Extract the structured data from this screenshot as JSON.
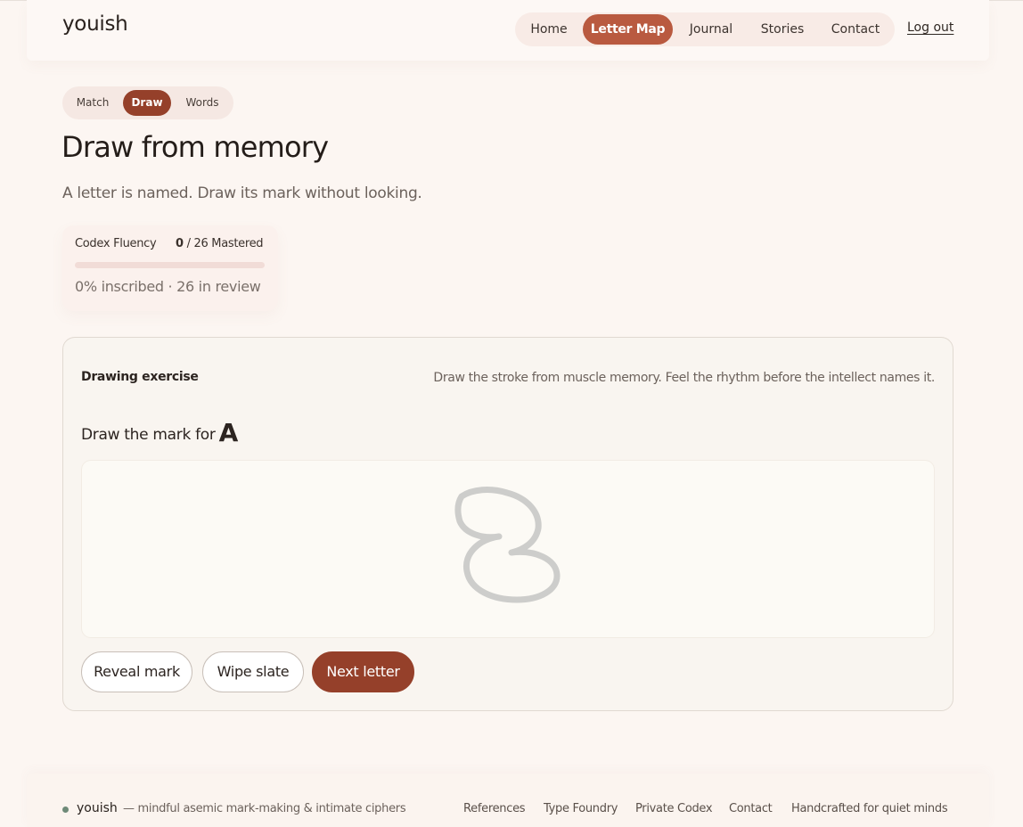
{
  "brand": "youish",
  "nav": {
    "items": [
      {
        "label": "Home",
        "active": false
      },
      {
        "label": "Letter Map",
        "active": true
      },
      {
        "label": "Journal",
        "active": false
      },
      {
        "label": "Stories",
        "active": false
      },
      {
        "label": "Contact",
        "active": false
      }
    ],
    "logout": "Log out"
  },
  "modes": [
    {
      "label": "Match",
      "active": false
    },
    {
      "label": "Draw",
      "active": true
    },
    {
      "label": "Words",
      "active": false
    }
  ],
  "page": {
    "title": "Draw from memory",
    "subtitle": "A letter is named. Draw its mark without looking."
  },
  "fluency": {
    "label": "Codex Fluency",
    "mastered_count": "0",
    "mastered_suffix": "/ 26 Mastered",
    "progress_fraction": 0,
    "stat": "0% inscribed · 26 in review"
  },
  "exercise": {
    "title": "Drawing exercise",
    "hint": "Draw the stroke from muscle memory. Feel the rhythm before the intellect names it.",
    "prompt": "Draw the mark for",
    "letter": "A",
    "buttons": {
      "reveal": "Reveal mark",
      "wipe": "Wipe slate",
      "next": "Next letter"
    }
  },
  "footer": {
    "brand": "youish",
    "tagline": "— mindful asemic mark-making & intimate ciphers",
    "links": [
      "References",
      "Type Foundry",
      "Private Codex",
      "Contact",
      "Handcrafted for quiet minds"
    ]
  },
  "colors": {
    "accent": "#b95a40",
    "accent_dark": "#95402a",
    "background": "#fcf6f2",
    "stroke": "#c8c8c6"
  }
}
